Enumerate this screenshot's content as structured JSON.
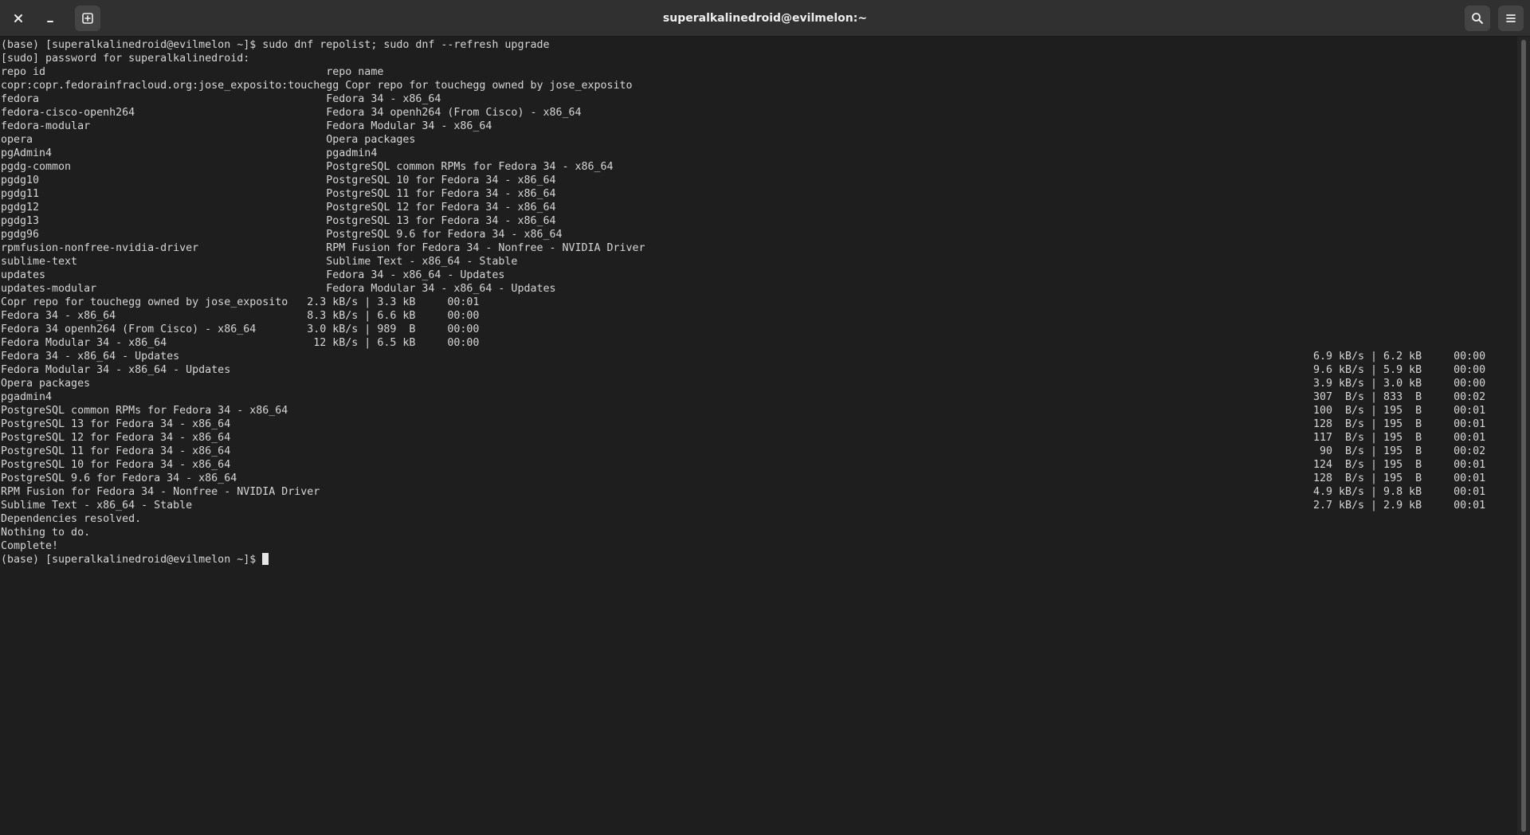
{
  "window": {
    "title": "superalkalinedroid@evilmelon:~"
  },
  "icons": {
    "close": "close-icon",
    "minimize": "minimize-icon",
    "new_tab": "new-tab-icon",
    "search": "search-icon",
    "menu": "hamburger-menu-icon"
  },
  "colors": {
    "background": "#1e1e1e",
    "headerbar": "#303030",
    "text": "#d6d6d6"
  },
  "terminal": {
    "lines": [
      {
        "text": "(base) [superalkalinedroid@evilmelon ~]$ sudo dnf repolist; sudo dnf --refresh upgrade",
        "right": ""
      },
      {
        "text": "[sudo] password for superalkalinedroid:",
        "right": ""
      },
      {
        "text": "repo id                                            repo name",
        "right": ""
      },
      {
        "text": "copr:copr.fedorainfracloud.org:jose_exposito:touchegg Copr repo for touchegg owned by jose_exposito",
        "right": ""
      },
      {
        "text": "fedora                                             Fedora 34 - x86_64",
        "right": ""
      },
      {
        "text": "fedora-cisco-openh264                              Fedora 34 openh264 (From Cisco) - x86_64",
        "right": ""
      },
      {
        "text": "fedora-modular                                     Fedora Modular 34 - x86_64",
        "right": ""
      },
      {
        "text": "opera                                              Opera packages",
        "right": ""
      },
      {
        "text": "pgAdmin4                                           pgadmin4",
        "right": ""
      },
      {
        "text": "pgdg-common                                        PostgreSQL common RPMs for Fedora 34 - x86_64",
        "right": ""
      },
      {
        "text": "pgdg10                                             PostgreSQL 10 for Fedora 34 - x86_64",
        "right": ""
      },
      {
        "text": "pgdg11                                             PostgreSQL 11 for Fedora 34 - x86_64",
        "right": ""
      },
      {
        "text": "pgdg12                                             PostgreSQL 12 for Fedora 34 - x86_64",
        "right": ""
      },
      {
        "text": "pgdg13                                             PostgreSQL 13 for Fedora 34 - x86_64",
        "right": ""
      },
      {
        "text": "pgdg96                                             PostgreSQL 9.6 for Fedora 34 - x86_64",
        "right": ""
      },
      {
        "text": "rpmfusion-nonfree-nvidia-driver                    RPM Fusion for Fedora 34 - Nonfree - NVIDIA Driver",
        "right": ""
      },
      {
        "text": "sublime-text                                       Sublime Text - x86_64 - Stable",
        "right": ""
      },
      {
        "text": "updates                                            Fedora 34 - x86_64 - Updates",
        "right": ""
      },
      {
        "text": "updates-modular                                    Fedora Modular 34 - x86_64 - Updates",
        "right": ""
      },
      {
        "text": "Copr repo for touchegg owned by jose_exposito   2.3 kB/s | 3.3 kB     00:01",
        "right": ""
      },
      {
        "text": "Fedora 34 - x86_64                              8.3 kB/s | 6.6 kB     00:00",
        "right": ""
      },
      {
        "text": "Fedora 34 openh264 (From Cisco) - x86_64        3.0 kB/s | 989  B     00:00",
        "right": ""
      },
      {
        "text": "Fedora Modular 34 - x86_64                       12 kB/s | 6.5 kB     00:00",
        "right": ""
      },
      {
        "text": "Fedora 34 - x86_64 - Updates",
        "right": "6.9 kB/s | 6.2 kB     00:00"
      },
      {
        "text": "Fedora Modular 34 - x86_64 - Updates",
        "right": "9.6 kB/s | 5.9 kB     00:00"
      },
      {
        "text": "Opera packages",
        "right": "3.9 kB/s | 3.0 kB     00:00"
      },
      {
        "text": "pgadmin4",
        "right": "307  B/s | 833  B     00:02"
      },
      {
        "text": "PostgreSQL common RPMs for Fedora 34 - x86_64",
        "right": "100  B/s | 195  B     00:01"
      },
      {
        "text": "PostgreSQL 13 for Fedora 34 - x86_64",
        "right": "128  B/s | 195  B     00:01"
      },
      {
        "text": "PostgreSQL 12 for Fedora 34 - x86_64",
        "right": "117  B/s | 195  B     00:01"
      },
      {
        "text": "PostgreSQL 11 for Fedora 34 - x86_64",
        "right": " 90  B/s | 195  B     00:02"
      },
      {
        "text": "PostgreSQL 10 for Fedora 34 - x86_64",
        "right": "124  B/s | 195  B     00:01"
      },
      {
        "text": "PostgreSQL 9.6 for Fedora 34 - x86_64",
        "right": "128  B/s | 195  B     00:01"
      },
      {
        "text": "RPM Fusion for Fedora 34 - Nonfree - NVIDIA Driver",
        "right": "4.9 kB/s | 9.8 kB     00:01"
      },
      {
        "text": "Sublime Text - x86_64 - Stable",
        "right": "2.7 kB/s | 2.9 kB     00:01"
      },
      {
        "text": "Dependencies resolved.",
        "right": ""
      },
      {
        "text": "Nothing to do.",
        "right": ""
      },
      {
        "text": "Complete!",
        "right": ""
      }
    ],
    "prompt": "(base) [superalkalinedroid@evilmelon ~]$ "
  }
}
